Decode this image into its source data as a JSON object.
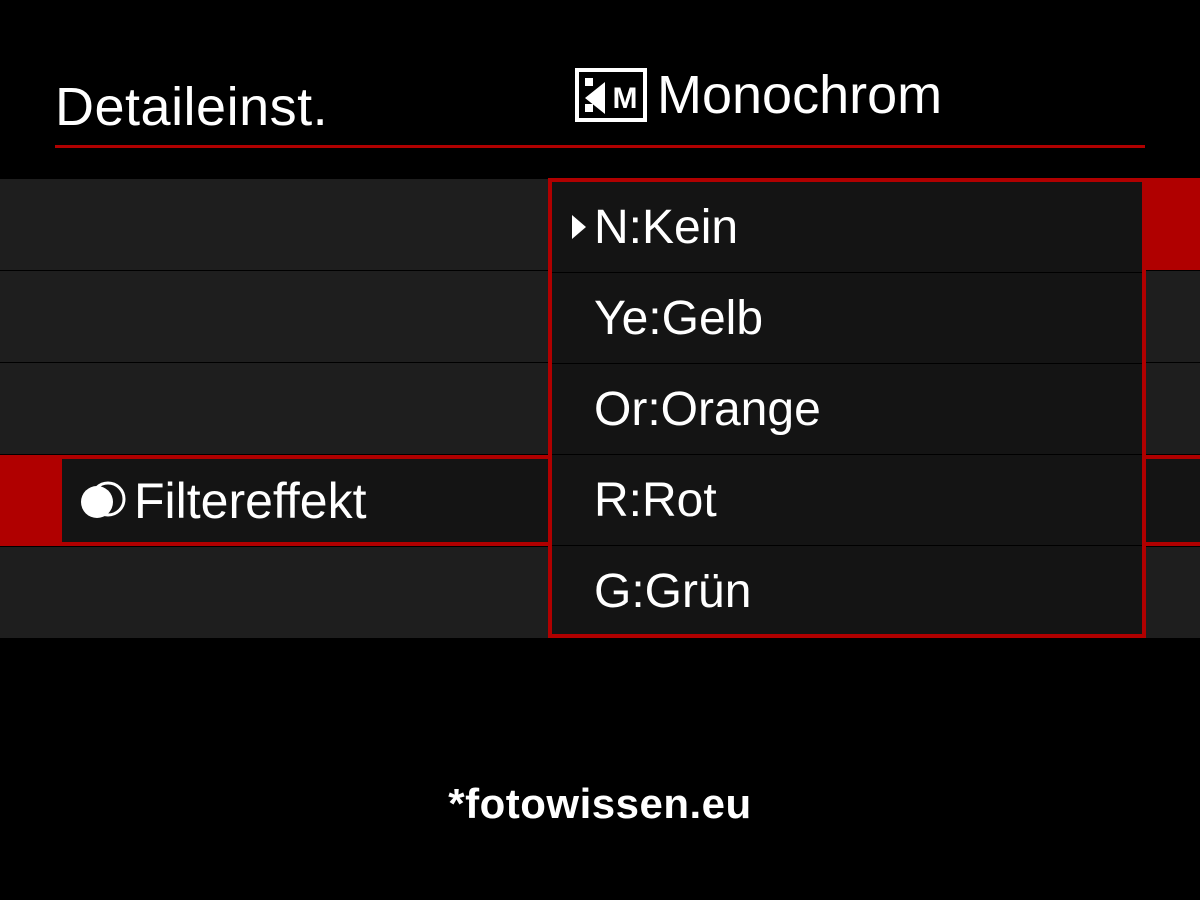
{
  "header": {
    "title": "Detaileinst.",
    "mode_icon": "picture-style-monochrome-icon",
    "mode_label": "Monochrom"
  },
  "selected_setting": {
    "icon": "filter-effect-icon",
    "label": "Filtereffekt"
  },
  "options": [
    {
      "label": "N:Kein",
      "selected": true
    },
    {
      "label": "Ye:Gelb",
      "selected": false
    },
    {
      "label": "Or:Orange",
      "selected": false
    },
    {
      "label": "R:Rot",
      "selected": false
    },
    {
      "label": "G:Grün",
      "selected": false
    }
  ],
  "watermark": "*fotowissen.eu",
  "colors": {
    "accent": "#b00000",
    "row_bg": "#1e1e1e"
  }
}
